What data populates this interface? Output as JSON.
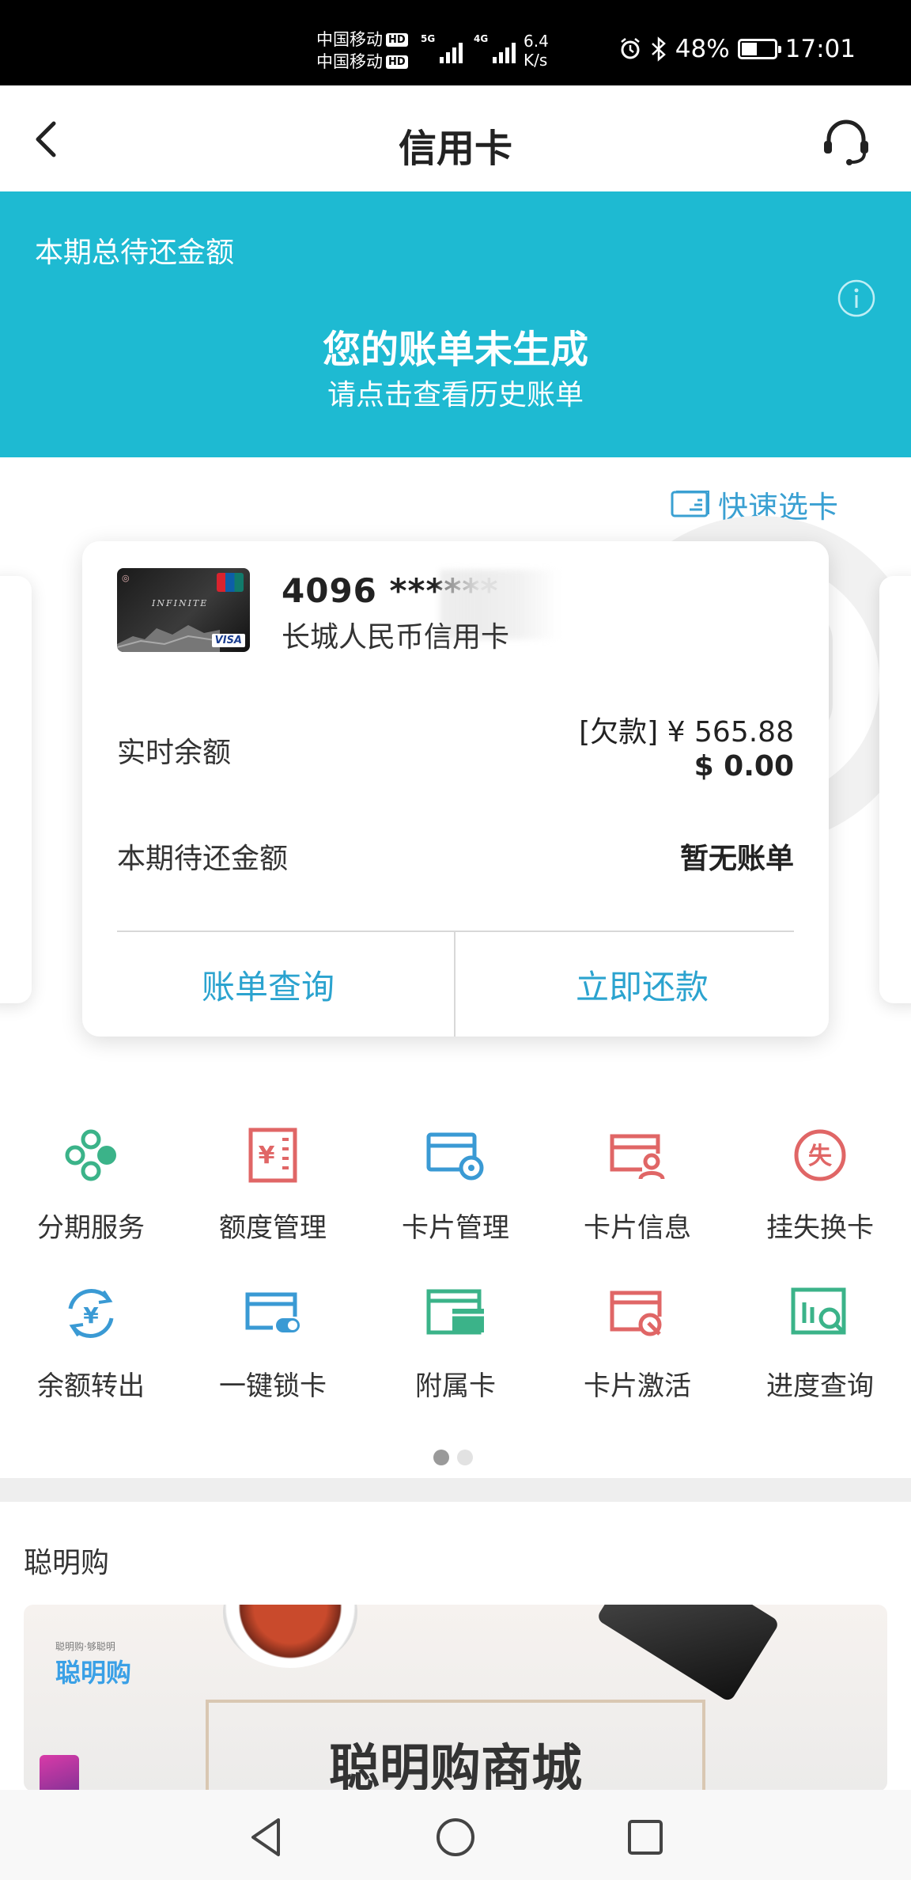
{
  "status_bar": {
    "carrier_1": "中国移动",
    "carrier_2": "中国移动",
    "hd_badge": "HD",
    "net_1": "5G",
    "net_2": "4G",
    "speed_value": "6.4",
    "speed_unit": "K/s",
    "battery_percent": "48%",
    "battery_level": 0.48,
    "time": "17:01"
  },
  "header": {
    "title": "信用卡"
  },
  "bill_banner": {
    "label": "本期总待还金额",
    "title": "您的账单未生成",
    "subtitle": "请点击查看历史账单"
  },
  "quick_select": {
    "label": "快速选卡"
  },
  "card": {
    "number": "4096 ******",
    "name": "长城人民币信用卡",
    "thumb_text": "INFINITE",
    "thumb_brand": "VISA",
    "balance_label": "实时余额",
    "balance_cny": "[欠款] ¥ 565.88",
    "balance_usd": "$ 0.00",
    "due_label": "本期待还金额",
    "due_value": "暂无账单",
    "action_bill": "账单查询",
    "action_pay": "立即还款"
  },
  "services": [
    {
      "label": "分期服务",
      "icon": "installment-icon",
      "color": "#3bb389"
    },
    {
      "label": "额度管理",
      "icon": "limit-icon",
      "color": "#e06666"
    },
    {
      "label": "卡片管理",
      "icon": "card-settings-icon",
      "color": "#3a9ad4"
    },
    {
      "label": "卡片信息",
      "icon": "card-user-icon",
      "color": "#e06666"
    },
    {
      "label": "挂失换卡",
      "icon": "lost-card-icon",
      "color": "#e06666"
    },
    {
      "label": "余额转出",
      "icon": "balance-transfer-icon",
      "color": "#3a9ad4"
    },
    {
      "label": "一键锁卡",
      "icon": "card-lock-icon",
      "color": "#3a9ad4"
    },
    {
      "label": "附属卡",
      "icon": "sub-card-icon",
      "color": "#3bb389"
    },
    {
      "label": "卡片激活",
      "icon": "card-activate-icon",
      "color": "#e06666"
    },
    {
      "label": "进度查询",
      "icon": "progress-search-icon",
      "color": "#3bb389"
    }
  ],
  "service_icon_glyphs": {
    "limit": "¥",
    "lost": "失",
    "transfer": "¥"
  },
  "pager": {
    "pages": 2,
    "active": 0
  },
  "promo": {
    "section_title": "聪明购",
    "logo_tagline": "聪明购·够聪明",
    "logo_text": "聪明购",
    "mall_title": "聪明购商城"
  },
  "colors": {
    "banner": "#1ebad2",
    "accent": "#2ba3cf",
    "green": "#3bb389",
    "red": "#e06666",
    "blue": "#3a9ad4"
  }
}
